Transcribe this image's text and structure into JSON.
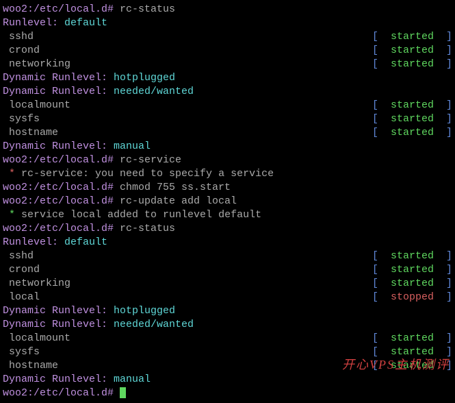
{
  "p1": "woo2:/etc/local.d# ",
  "c1": "rc-status",
  "rl": "Runlevel: ",
  "rl_def": "default",
  "drl": "Dynamic Runlevel: ",
  "drl_hot": "hotplugged",
  "drl_need": "needed/wanted",
  "drl_man": "manual",
  "svc_sshd": " sshd",
  "svc_crond": " crond",
  "svc_networking": " networking",
  "svc_localmount": " localmount",
  "svc_sysfs": " sysfs",
  "svc_hostname": " hostname",
  "svc_local": " local",
  "lb": "[",
  "rb": "]",
  "started": "  started  ",
  "stopped": "  stopped  ",
  "c2": "rc-service",
  "star": " * ",
  "err1": "rc-service: you need to specify a service",
  "c3": "chmod 755 ss.start",
  "c4": "rc-update add local",
  "msg1": "service local added to runlevel default",
  "watermark": "开心VPS主机测评",
  "last": "woo2:/etc/local.d# "
}
